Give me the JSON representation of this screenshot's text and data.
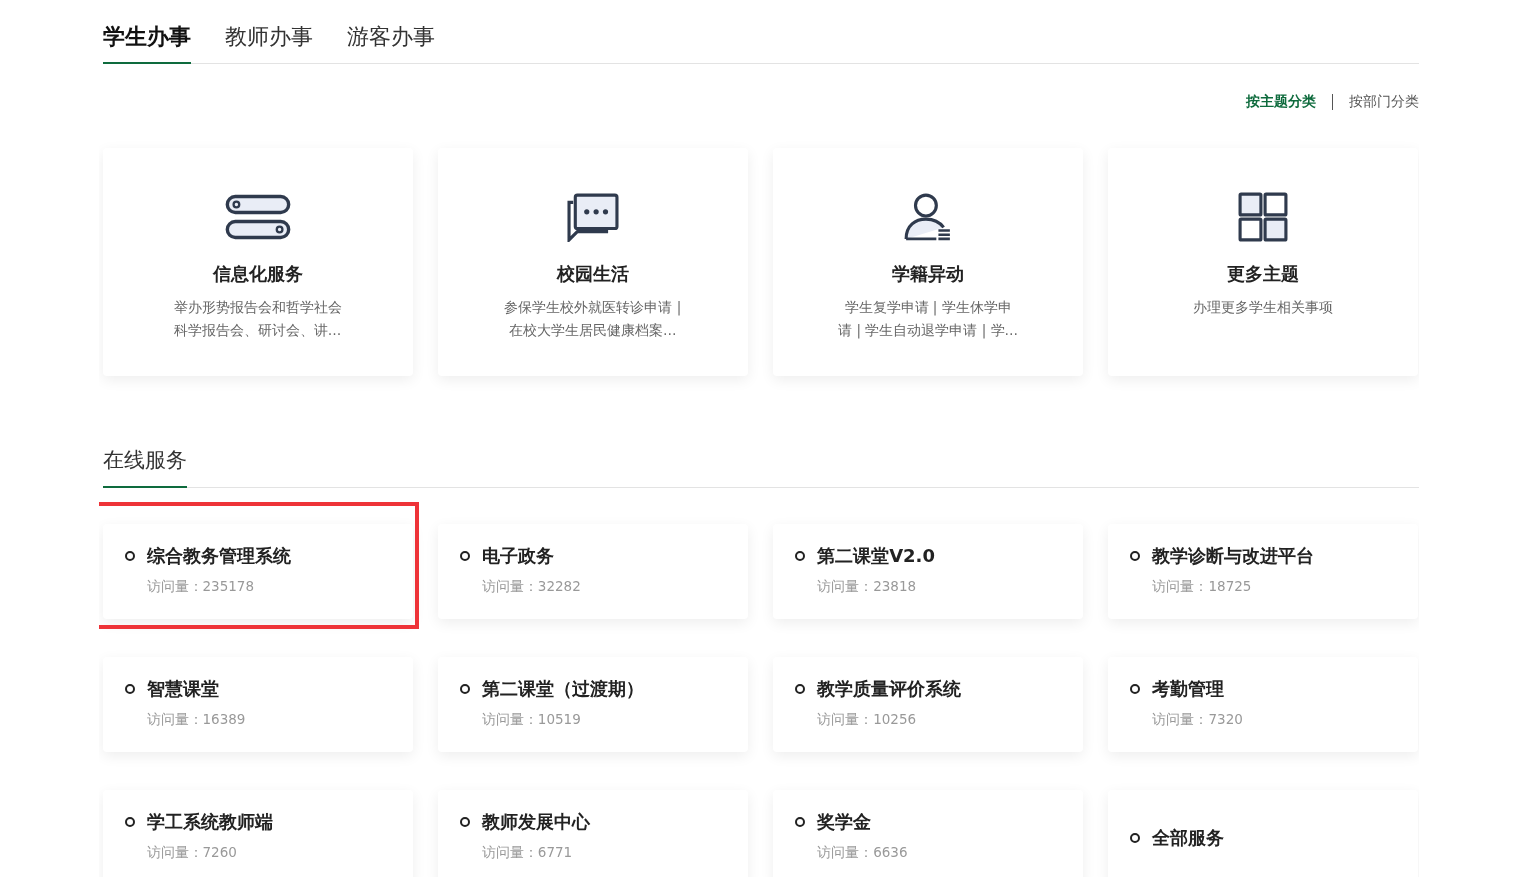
{
  "tabs": [
    {
      "label": "学生办事",
      "selected": true
    },
    {
      "label": "教师办事",
      "selected": false
    },
    {
      "label": "游客办事",
      "selected": false
    }
  ],
  "sort_options": [
    {
      "label": "按主题分类",
      "selected": true
    },
    {
      "label": "按部门分类",
      "selected": false
    }
  ],
  "topics": [
    {
      "kind": "server",
      "title": "信息化服务",
      "description_lines": [
        "举办形势报告会和哲学社会",
        "科学报告会、研讨会、讲…"
      ]
    },
    {
      "kind": "chat",
      "title": "校园生活",
      "description_lines": [
        "参保学生校外就医转诊申请 |",
        "在校大学生居民健康档案…"
      ]
    },
    {
      "kind": "user",
      "title": "学籍异动",
      "description_lines": [
        "学生复学申请 | 学生休学申",
        "请 | 学生自动退学申请 | 学…"
      ]
    },
    {
      "kind": "grid",
      "title": "更多主题",
      "description_lines": [
        "办理更多学生相关事项"
      ]
    }
  ],
  "online_services": {
    "title": "在线服务",
    "items": [
      {
        "name": "综合教务管理系统",
        "visits": "访问量：235178",
        "highlighted": true
      },
      {
        "name": "电子政务",
        "visits": "访问量：32282",
        "highlighted": false
      },
      {
        "name": "第二课堂V2.0",
        "visits": "访问量：23818",
        "highlighted": false
      },
      {
        "name": "教学诊断与改进平台",
        "visits": "访问量：18725",
        "highlighted": false
      },
      {
        "name": "智慧课堂",
        "visits": "访问量：16389",
        "highlighted": false
      },
      {
        "name": "第二课堂（过渡期）",
        "visits": "访问量：10519",
        "highlighted": false
      },
      {
        "name": "教学质量评价系统",
        "visits": "访问量：10256",
        "highlighted": false
      },
      {
        "name": "考勤管理",
        "visits": "访问量：7320",
        "highlighted": false
      },
      {
        "name": "学工系统教师端",
        "visits": "访问量：7260",
        "highlighted": false
      },
      {
        "name": "教师发展中心",
        "visits": "访问量：6771",
        "highlighted": false
      },
      {
        "name": "奖学金",
        "visits": "访问量：6636",
        "highlighted": false
      },
      {
        "name": "全部服务",
        "highlighted": false
      }
    ]
  }
}
